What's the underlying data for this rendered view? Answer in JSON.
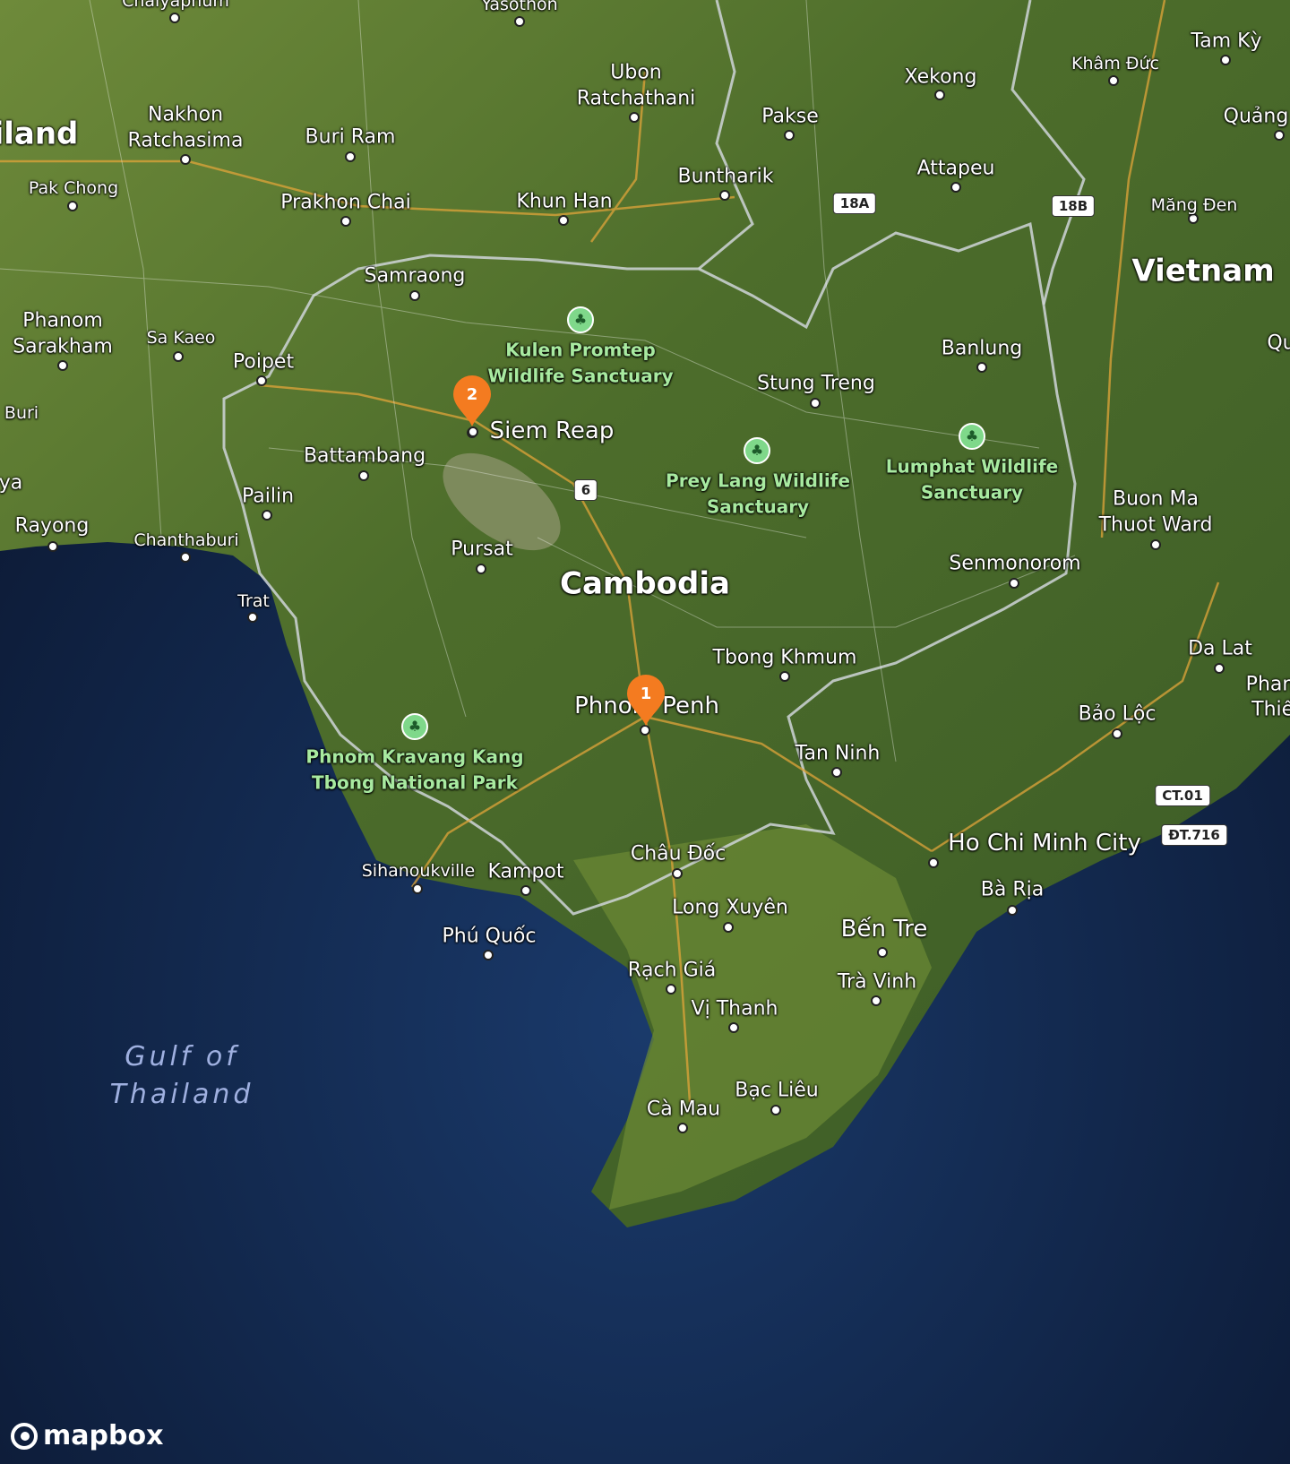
{
  "map": {
    "countries": [
      "iland",
      "Cambodia",
      "Vietnam"
    ],
    "water": [
      "Gulf of",
      "Thailand"
    ],
    "cities": [
      "Chaiyaphum",
      "Yasothon",
      "Ubon",
      "Ratchathani",
      "Nakhon",
      "Ratchasima",
      "Buri Ram",
      "Pakse",
      "Xekong",
      "Tam Kỳ",
      "Khâm Đức",
      "Quảng",
      "Pak Chong",
      "Prakhon Chai",
      "Khun Han",
      "Bunthari​k",
      "Attapeu",
      "Măng Đen",
      "Samraong",
      "Phanom",
      "Sarakham",
      "Sa Kaeo",
      "Poipet",
      "Banlung",
      "Stung Treng",
      "Siem Reap",
      "Battambang",
      "Pailin",
      "Rayong",
      "Chanthaburi",
      "Buon Ma",
      "Thuot Ward",
      "Pursat",
      "Senmonorom",
      "Trat",
      "Da Lat",
      "Tbong Khmum",
      "Phnom Penh",
      "Tan Ninh",
      "Bảo Lộc",
      "Phan",
      "Thiết",
      "Châu Đốc",
      "Ho Chi Minh City",
      "Sihanoukville",
      "Kampot",
      "Bà Rịa",
      "Long Xuyên",
      "Bến Tre",
      "Phú Quốc",
      "Rạch Giá",
      "Trà Vinh",
      "Vị Thanh",
      "Bạc Liêu",
      "Cà Mau",
      "Buri",
      "ya",
      "Qu"
    ],
    "parks": [
      "Kulen Promtep",
      "Wildlife Sanctuary",
      "Prey Lang Wildlife",
      "Sanctuary",
      "Lumphat Wildlife",
      "Sanctuary",
      "Phnom Kravang Kang",
      "Tbong National Park"
    ],
    "shields": [
      "18A",
      "18B",
      "6",
      "CT.01",
      "ĐT.716"
    ],
    "markers": [
      "1",
      "2"
    ],
    "attribution": "mapbox",
    "icons": [
      "park-icon",
      "map-marker-icon",
      "mapbox-logo-icon"
    ],
    "colors": {
      "sea": "#0b1730",
      "land": "#4a6a2a",
      "marker": "#f47b20",
      "park": "#7fd88a"
    }
  }
}
